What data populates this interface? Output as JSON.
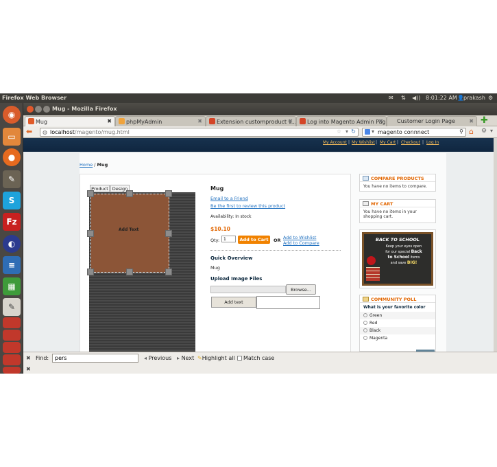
{
  "os": {
    "app_title": "Firefox Web Browser",
    "time": "8:01:22 AM",
    "user": "prakash"
  },
  "window": {
    "title": "Mug - Mozilla Firefox"
  },
  "tabs": [
    {
      "label": "Mug",
      "active": true
    },
    {
      "label": "phpMyAdmin",
      "active": false
    },
    {
      "label": "Extension customproduct v...",
      "active": false
    },
    {
      "label": "Log into Magento Admin Page",
      "active": false
    },
    {
      "label": "Customer Login Page",
      "active": false
    }
  ],
  "navbar": {
    "url_host": "localhost",
    "url_path": "/magento/mug.html",
    "search_value": "magento connnect"
  },
  "store": {
    "links": [
      "My Account",
      "My Wishlist",
      "My Cart",
      "Checkout",
      "Log In"
    ],
    "breadcrumb": {
      "home": "Home",
      "separator": " / ",
      "current": "Mug"
    }
  },
  "designer": {
    "tabs": [
      "Product",
      "Design"
    ],
    "canvas_text": "Add Text"
  },
  "product": {
    "name": "Mug",
    "email_friend": "Email to a Friend",
    "review": "Be the first to review this product",
    "availability": "Availability: In stock",
    "price": "$10.10",
    "qty_label": "Qty:",
    "qty_value": "1",
    "add_to_cart": "Add to Cart",
    "or": "OR",
    "add_wishlist": "Add to Wishlist",
    "add_compare": "Add to Compare",
    "quick_overview": "Quick Overview",
    "short_desc": "Mug",
    "upload_heading": "Upload Image Files",
    "browse": "Browse...",
    "add_text_button": "Add text"
  },
  "sidebar": {
    "compare": {
      "title": "COMPARE PRODUCTS",
      "text": "You have no items to compare."
    },
    "cart": {
      "title": "MY CART",
      "text": "You have no items in your shopping cart."
    },
    "banner": {
      "heading": "BACK TO SCHOOL",
      "line1": "Keep your eyes open",
      "line2": "for our special",
      "highlight1": "Back",
      "line3": "to School",
      "line4": "items",
      "line5": "and save",
      "highlight2": "BIG!"
    },
    "poll": {
      "title": "COMMUNITY POLL",
      "question": "What is your favorite color",
      "options": [
        "Green",
        "Red",
        "Black",
        "Magenta"
      ]
    }
  },
  "findbar": {
    "label": "Find:",
    "value": "pers",
    "previous": "Previous",
    "next": "Next",
    "highlight_all": "Highlight all",
    "match_case": "Match case"
  }
}
